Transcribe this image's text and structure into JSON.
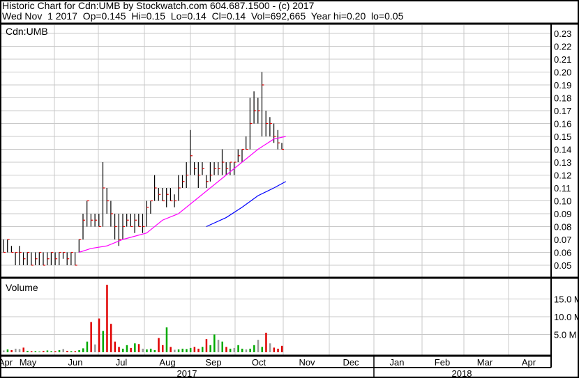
{
  "header": {
    "line1": "Historic Chart for Cdn:UMB by Stockwatch.com 604.687.1500 - (c) 2017",
    "line2": "Wed Nov  1 2017  Op=0.145  Hi=0.15  Lo=0.14  Cl=0.14  Vol=692,665  Year hi=0.20  lo=0.05"
  },
  "chart_data": {
    "type": "ohlc",
    "symbol": "Cdn:UMB",
    "volume_label": "Volume",
    "price_ticks": [
      "0.05",
      "0.06",
      "0.07",
      "0.08",
      "0.09",
      "0.10",
      "0.11",
      "0.12",
      "0.13",
      "0.14",
      "0.15",
      "0.16",
      "0.17",
      "0.18",
      "0.19",
      "0.20",
      "0.21",
      "0.22",
      "0.23"
    ],
    "ylim": [
      0.04,
      0.235
    ],
    "volume_ticks": [
      "5.0 M",
      "10.0 M",
      "15.0 M"
    ],
    "volume_ylim_millions": [
      0,
      20
    ],
    "months": [
      "Apr",
      "May",
      "Jun",
      "Jul",
      "Aug",
      "Sep",
      "Oct",
      "Nov",
      "Dec",
      "Jan",
      "Feb",
      "Mar",
      "Apr"
    ],
    "years": [
      "2017",
      "2018"
    ],
    "bars": [
      [
        0.07,
        0.06,
        0.06
      ],
      [
        0.07,
        0.06,
        0.07
      ],
      [
        0.065,
        0.06,
        0.06
      ],
      [
        0.06,
        0.05,
        0.06
      ],
      [
        0.065,
        0.05,
        0.06
      ],
      [
        0.06,
        0.05,
        0.055
      ],
      [
        0.06,
        0.05,
        0.06
      ],
      [
        0.06,
        0.05,
        0.05
      ],
      [
        0.06,
        0.05,
        0.055
      ],
      [
        0.06,
        0.05,
        0.06
      ],
      [
        0.06,
        0.05,
        0.05
      ],
      [
        0.06,
        0.05,
        0.055
      ],
      [
        0.06,
        0.05,
        0.06
      ],
      [
        0.06,
        0.05,
        0.055
      ],
      [
        0.06,
        0.05,
        0.06
      ],
      [
        0.06,
        0.055,
        0.06
      ],
      [
        0.06,
        0.05,
        0.055
      ],
      [
        0.06,
        0.05,
        0.06
      ],
      [
        0.06,
        0.05,
        0.05
      ],
      [
        0.07,
        0.06,
        0.07
      ],
      [
        0.09,
        0.07,
        0.085
      ],
      [
        0.1,
        0.08,
        0.1
      ],
      [
        0.09,
        0.08,
        0.085
      ],
      [
        0.09,
        0.08,
        0.085
      ],
      [
        0.09,
        0.08,
        0.08
      ],
      [
        0.13,
        0.08,
        0.11
      ],
      [
        0.11,
        0.09,
        0.1
      ],
      [
        0.1,
        0.08,
        0.09
      ],
      [
        0.09,
        0.07,
        0.08
      ],
      [
        0.09,
        0.065,
        0.07
      ],
      [
        0.09,
        0.07,
        0.08
      ],
      [
        0.09,
        0.08,
        0.085
      ],
      [
        0.09,
        0.08,
        0.08
      ],
      [
        0.09,
        0.075,
        0.085
      ],
      [
        0.09,
        0.08,
        0.08
      ],
      [
        0.09,
        0.075,
        0.08
      ],
      [
        0.1,
        0.08,
        0.095
      ],
      [
        0.1,
        0.09,
        0.1
      ],
      [
        0.12,
        0.1,
        0.11
      ],
      [
        0.11,
        0.1,
        0.105
      ],
      [
        0.11,
        0.1,
        0.1
      ],
      [
        0.11,
        0.095,
        0.105
      ],
      [
        0.11,
        0.1,
        0.1
      ],
      [
        0.105,
        0.095,
        0.1
      ],
      [
        0.12,
        0.1,
        0.11
      ],
      [
        0.12,
        0.11,
        0.115
      ],
      [
        0.13,
        0.11,
        0.12
      ],
      [
        0.155,
        0.12,
        0.135
      ],
      [
        0.13,
        0.12,
        0.125
      ],
      [
        0.13,
        0.11,
        0.12
      ],
      [
        0.13,
        0.12,
        0.125
      ],
      [
        0.12,
        0.11,
        0.115
      ],
      [
        0.13,
        0.115,
        0.12
      ],
      [
        0.13,
        0.12,
        0.125
      ],
      [
        0.13,
        0.12,
        0.125
      ],
      [
        0.14,
        0.12,
        0.13
      ],
      [
        0.13,
        0.12,
        0.125
      ],
      [
        0.13,
        0.12,
        0.13
      ],
      [
        0.13,
        0.12,
        0.13
      ],
      [
        0.14,
        0.13,
        0.135
      ],
      [
        0.14,
        0.13,
        0.14
      ],
      [
        0.15,
        0.14,
        0.14
      ],
      [
        0.18,
        0.14,
        0.16
      ],
      [
        0.185,
        0.16,
        0.17
      ],
      [
        0.18,
        0.16,
        0.17
      ],
      [
        0.2,
        0.15,
        0.19
      ],
      [
        0.17,
        0.15,
        0.16
      ],
      [
        0.165,
        0.15,
        0.16
      ],
      [
        0.16,
        0.145,
        0.15
      ],
      [
        0.155,
        0.14,
        0.145
      ],
      [
        0.145,
        0.14,
        0.14
      ]
    ],
    "volumes_millions": [
      0.5,
      0.8,
      0.6,
      1.0,
      0.9,
      1.3,
      0.4,
      0.3,
      0.3,
      0.2,
      0.4,
      0.5,
      0.3,
      0.3,
      0.6,
      0.9,
      0.4,
      0.3,
      0.3,
      0.6,
      1.1,
      3.0,
      8.5,
      2.2,
      9.5,
      6.0,
      19.0,
      8.0,
      3.0,
      1.5,
      1.0,
      2.0,
      1.2,
      2.5,
      2.3,
      1.0,
      0.8,
      1.0,
      0.6,
      4.0,
      2.0,
      7.0,
      1.5,
      0.7,
      0.8,
      1.0,
      0.9,
      1.2,
      1.5,
      1.0,
      1.5,
      3.7,
      2.0,
      5.0,
      3.5,
      3.0,
      1.5,
      1.0,
      1.2,
      2.0,
      1.0,
      0.8,
      1.0,
      2.0,
      3.5,
      1.5,
      5.5,
      2.5,
      1.3,
      1.0,
      1.8
    ],
    "ma_pink": [
      [
        19,
        0.06
      ],
      [
        22,
        0.063
      ],
      [
        26,
        0.065
      ],
      [
        30,
        0.07
      ],
      [
        36,
        0.075
      ],
      [
        40,
        0.085
      ],
      [
        44,
        0.09
      ],
      [
        48,
        0.1
      ],
      [
        52,
        0.11
      ],
      [
        56,
        0.12
      ],
      [
        60,
        0.13
      ],
      [
        64,
        0.14
      ],
      [
        68,
        0.148
      ],
      [
        71,
        0.15
      ]
    ],
    "ma_blue": [
      [
        51,
        0.08
      ],
      [
        56,
        0.087
      ],
      [
        60,
        0.095
      ],
      [
        64,
        0.104
      ],
      [
        68,
        0.11
      ],
      [
        71,
        0.115
      ]
    ],
    "colors": {
      "up": "#00aa00",
      "down": "#e00000",
      "flat": "#999999",
      "bar": "#000000",
      "bar_tick": "#e00000",
      "ma_pink": "#ff00ff",
      "ma_blue": "#0000ff",
      "grid": "#c8c8c8"
    }
  }
}
